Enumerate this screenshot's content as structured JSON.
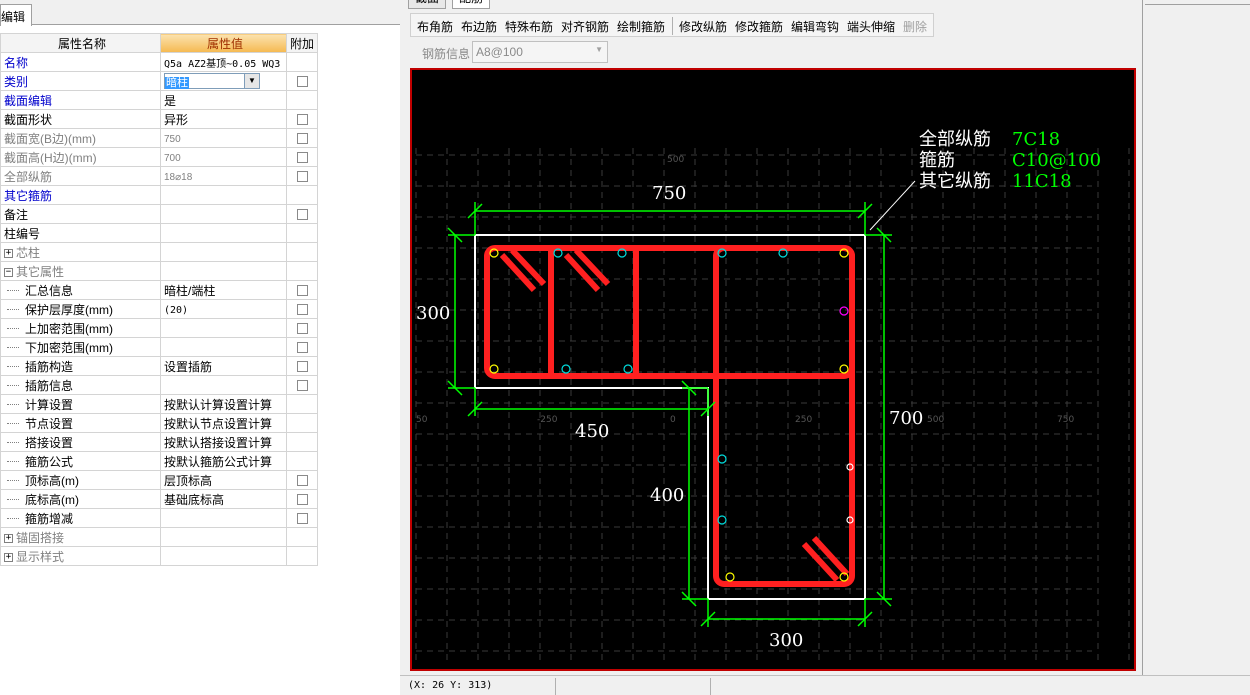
{
  "left_tab": {
    "label": "编辑"
  },
  "grid": {
    "headers": {
      "name": "属性名称",
      "value": "属性值",
      "add": "附加"
    },
    "rows": [
      {
        "name": "名称",
        "value": "Q5a AZ2基顶~0.05 WQ3",
        "style": "blue",
        "value_small": true,
        "checkbox": false
      },
      {
        "name": "类别",
        "value": "暗柱",
        "style": "blue",
        "combo": true,
        "checkbox": true
      },
      {
        "name": "截面编辑",
        "value": "是",
        "style": "blue",
        "checkbox": false
      },
      {
        "name": "截面形状",
        "value": "异形",
        "style": "",
        "checkbox": true
      },
      {
        "name": "截面宽(B边)(mm)",
        "value": "750",
        "style": "gray",
        "value_gray": true,
        "checkbox": true
      },
      {
        "name": "截面高(H边)(mm)",
        "value": "700",
        "style": "gray",
        "value_gray": true,
        "checkbox": true
      },
      {
        "name": "全部纵筋",
        "value": "18⌀18",
        "style": "gray",
        "value_gray": true,
        "checkbox": true
      },
      {
        "name": "其它箍筋",
        "value": "",
        "style": "blue",
        "checkbox": false
      },
      {
        "name": "备注",
        "value": "",
        "style": "",
        "checkbox": true
      },
      {
        "name": "柱编号",
        "value": "",
        "style": "",
        "checkbox": false
      },
      {
        "name": "芯柱",
        "value": "",
        "style": "gray",
        "group": true,
        "checkbox": false
      },
      {
        "name": "其它属性",
        "value": "",
        "style": "gray",
        "group": true,
        "expanded": true,
        "checkbox": false
      },
      {
        "name": "汇总信息",
        "value": "暗柱/端柱",
        "indent": true,
        "checkbox": true
      },
      {
        "name": "保护层厚度(mm)",
        "value": "(20)",
        "indent": true,
        "value_small": true,
        "checkbox": true
      },
      {
        "name": "上加密范围(mm)",
        "value": "",
        "indent": true,
        "checkbox": true
      },
      {
        "name": "下加密范围(mm)",
        "value": "",
        "indent": true,
        "checkbox": true
      },
      {
        "name": "插筋构造",
        "value": "设置插筋",
        "indent": true,
        "checkbox": true
      },
      {
        "name": "插筋信息",
        "value": "",
        "indent": true,
        "checkbox": true
      },
      {
        "name": "计算设置",
        "value": "按默认计算设置计算",
        "indent": true,
        "checkbox": false
      },
      {
        "name": "节点设置",
        "value": "按默认节点设置计算",
        "indent": true,
        "checkbox": false
      },
      {
        "name": "搭接设置",
        "value": "按默认搭接设置计算",
        "indent": true,
        "checkbox": false
      },
      {
        "name": "箍筋公式",
        "value": "按默认箍筋公式计算",
        "indent": true,
        "checkbox": false
      },
      {
        "name": "顶标高(m)",
        "value": "层顶标高",
        "indent": true,
        "checkbox": true
      },
      {
        "name": "底标高(m)",
        "value": "基础底标高",
        "indent": true,
        "checkbox": true
      },
      {
        "name": "箍筋增减",
        "value": "",
        "indent": true,
        "checkbox": true
      },
      {
        "name": "锚固搭接",
        "value": "",
        "style": "gray",
        "group": true,
        "checkbox": false
      },
      {
        "name": "显示样式",
        "value": "",
        "style": "gray",
        "group": true,
        "checkbox": false
      }
    ]
  },
  "tabs": {
    "section": "截面",
    "rebar": "配筋"
  },
  "toolbar": {
    "buttons": [
      "布角筋",
      "布边筋",
      "特殊布筋",
      "对齐钢筋",
      "绘制箍筋",
      "修改纵筋",
      "修改箍筋",
      "编辑弯钩",
      "端头伸缩",
      "删除"
    ]
  },
  "rebar_info": {
    "label": "钢筋信息",
    "value": "A8@100"
  },
  "drawing": {
    "legend": [
      {
        "label": "全部纵筋",
        "value": "7C18"
      },
      {
        "label": "箍筋",
        "value": "C10@100"
      },
      {
        "label": "其它纵筋",
        "value": "11C18"
      }
    ],
    "dimensions": {
      "top": "750",
      "left": "300",
      "middle": "450",
      "right": "700",
      "inner_vertical": "400",
      "bottom": "300"
    },
    "axis_labels": {
      "top": "500",
      "neg250": "-250",
      "zero": "0",
      "pos250": "250",
      "pos500": "500",
      "pos750": "750",
      "left_edge": "50"
    },
    "colors": {
      "background": "#000000",
      "section_outline": "#ffffff",
      "stirrup": "#ff0000",
      "dimension": "#00ff00",
      "legend_value": "#00ff00",
      "legend_label": "#ffffff"
    }
  },
  "status": {
    "coords": "(X: 26 Y: 313)"
  }
}
